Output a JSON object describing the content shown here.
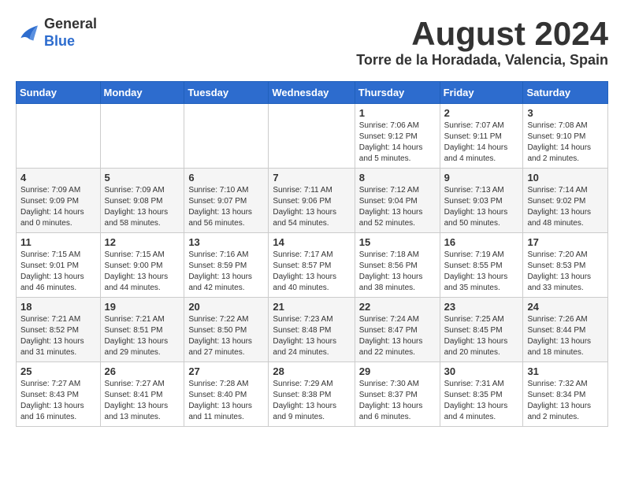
{
  "header": {
    "logo_general": "General",
    "logo_blue": "Blue",
    "title": "August 2024",
    "location": "Torre de la Horadada, Valencia, Spain"
  },
  "days_of_week": [
    "Sunday",
    "Monday",
    "Tuesday",
    "Wednesday",
    "Thursday",
    "Friday",
    "Saturday"
  ],
  "weeks": [
    {
      "days": [
        {
          "num": "",
          "info": ""
        },
        {
          "num": "",
          "info": ""
        },
        {
          "num": "",
          "info": ""
        },
        {
          "num": "",
          "info": ""
        },
        {
          "num": "1",
          "info": "Sunrise: 7:06 AM\nSunset: 9:12 PM\nDaylight: 14 hours\nand 5 minutes."
        },
        {
          "num": "2",
          "info": "Sunrise: 7:07 AM\nSunset: 9:11 PM\nDaylight: 14 hours\nand 4 minutes."
        },
        {
          "num": "3",
          "info": "Sunrise: 7:08 AM\nSunset: 9:10 PM\nDaylight: 14 hours\nand 2 minutes."
        }
      ]
    },
    {
      "days": [
        {
          "num": "4",
          "info": "Sunrise: 7:09 AM\nSunset: 9:09 PM\nDaylight: 14 hours\nand 0 minutes."
        },
        {
          "num": "5",
          "info": "Sunrise: 7:09 AM\nSunset: 9:08 PM\nDaylight: 13 hours\nand 58 minutes."
        },
        {
          "num": "6",
          "info": "Sunrise: 7:10 AM\nSunset: 9:07 PM\nDaylight: 13 hours\nand 56 minutes."
        },
        {
          "num": "7",
          "info": "Sunrise: 7:11 AM\nSunset: 9:06 PM\nDaylight: 13 hours\nand 54 minutes."
        },
        {
          "num": "8",
          "info": "Sunrise: 7:12 AM\nSunset: 9:04 PM\nDaylight: 13 hours\nand 52 minutes."
        },
        {
          "num": "9",
          "info": "Sunrise: 7:13 AM\nSunset: 9:03 PM\nDaylight: 13 hours\nand 50 minutes."
        },
        {
          "num": "10",
          "info": "Sunrise: 7:14 AM\nSunset: 9:02 PM\nDaylight: 13 hours\nand 48 minutes."
        }
      ]
    },
    {
      "days": [
        {
          "num": "11",
          "info": "Sunrise: 7:15 AM\nSunset: 9:01 PM\nDaylight: 13 hours\nand 46 minutes."
        },
        {
          "num": "12",
          "info": "Sunrise: 7:15 AM\nSunset: 9:00 PM\nDaylight: 13 hours\nand 44 minutes."
        },
        {
          "num": "13",
          "info": "Sunrise: 7:16 AM\nSunset: 8:59 PM\nDaylight: 13 hours\nand 42 minutes."
        },
        {
          "num": "14",
          "info": "Sunrise: 7:17 AM\nSunset: 8:57 PM\nDaylight: 13 hours\nand 40 minutes."
        },
        {
          "num": "15",
          "info": "Sunrise: 7:18 AM\nSunset: 8:56 PM\nDaylight: 13 hours\nand 38 minutes."
        },
        {
          "num": "16",
          "info": "Sunrise: 7:19 AM\nSunset: 8:55 PM\nDaylight: 13 hours\nand 35 minutes."
        },
        {
          "num": "17",
          "info": "Sunrise: 7:20 AM\nSunset: 8:53 PM\nDaylight: 13 hours\nand 33 minutes."
        }
      ]
    },
    {
      "days": [
        {
          "num": "18",
          "info": "Sunrise: 7:21 AM\nSunset: 8:52 PM\nDaylight: 13 hours\nand 31 minutes."
        },
        {
          "num": "19",
          "info": "Sunrise: 7:21 AM\nSunset: 8:51 PM\nDaylight: 13 hours\nand 29 minutes."
        },
        {
          "num": "20",
          "info": "Sunrise: 7:22 AM\nSunset: 8:50 PM\nDaylight: 13 hours\nand 27 minutes."
        },
        {
          "num": "21",
          "info": "Sunrise: 7:23 AM\nSunset: 8:48 PM\nDaylight: 13 hours\nand 24 minutes."
        },
        {
          "num": "22",
          "info": "Sunrise: 7:24 AM\nSunset: 8:47 PM\nDaylight: 13 hours\nand 22 minutes."
        },
        {
          "num": "23",
          "info": "Sunrise: 7:25 AM\nSunset: 8:45 PM\nDaylight: 13 hours\nand 20 minutes."
        },
        {
          "num": "24",
          "info": "Sunrise: 7:26 AM\nSunset: 8:44 PM\nDaylight: 13 hours\nand 18 minutes."
        }
      ]
    },
    {
      "days": [
        {
          "num": "25",
          "info": "Sunrise: 7:27 AM\nSunset: 8:43 PM\nDaylight: 13 hours\nand 16 minutes."
        },
        {
          "num": "26",
          "info": "Sunrise: 7:27 AM\nSunset: 8:41 PM\nDaylight: 13 hours\nand 13 minutes."
        },
        {
          "num": "27",
          "info": "Sunrise: 7:28 AM\nSunset: 8:40 PM\nDaylight: 13 hours\nand 11 minutes."
        },
        {
          "num": "28",
          "info": "Sunrise: 7:29 AM\nSunset: 8:38 PM\nDaylight: 13 hours\nand 9 minutes."
        },
        {
          "num": "29",
          "info": "Sunrise: 7:30 AM\nSunset: 8:37 PM\nDaylight: 13 hours\nand 6 minutes."
        },
        {
          "num": "30",
          "info": "Sunrise: 7:31 AM\nSunset: 8:35 PM\nDaylight: 13 hours\nand 4 minutes."
        },
        {
          "num": "31",
          "info": "Sunrise: 7:32 AM\nSunset: 8:34 PM\nDaylight: 13 hours\nand 2 minutes."
        }
      ]
    }
  ]
}
